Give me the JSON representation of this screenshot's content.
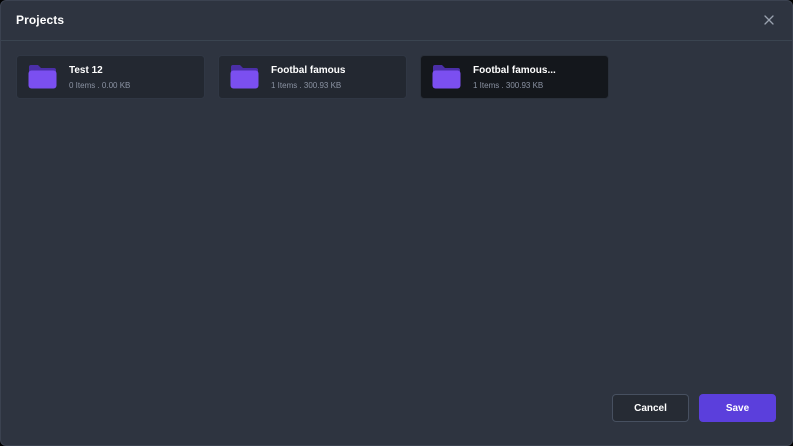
{
  "modal": {
    "title": "Projects"
  },
  "folders": [
    {
      "name": "Test 12",
      "meta": "0 Items . 0.00 KB",
      "selected": false
    },
    {
      "name": "Footbal famous",
      "meta": "1 Items . 300.93 KB",
      "selected": false
    },
    {
      "name": "Footbal famous...",
      "meta": "1 Items . 300.93 KB",
      "selected": true
    }
  ],
  "footer": {
    "cancel_label": "Cancel",
    "save_label": "Save"
  },
  "colors": {
    "accent": "#5b3fdc",
    "folder": "#7b4ff0"
  },
  "icons": {
    "close": "close-icon",
    "folder": "folder-icon"
  }
}
